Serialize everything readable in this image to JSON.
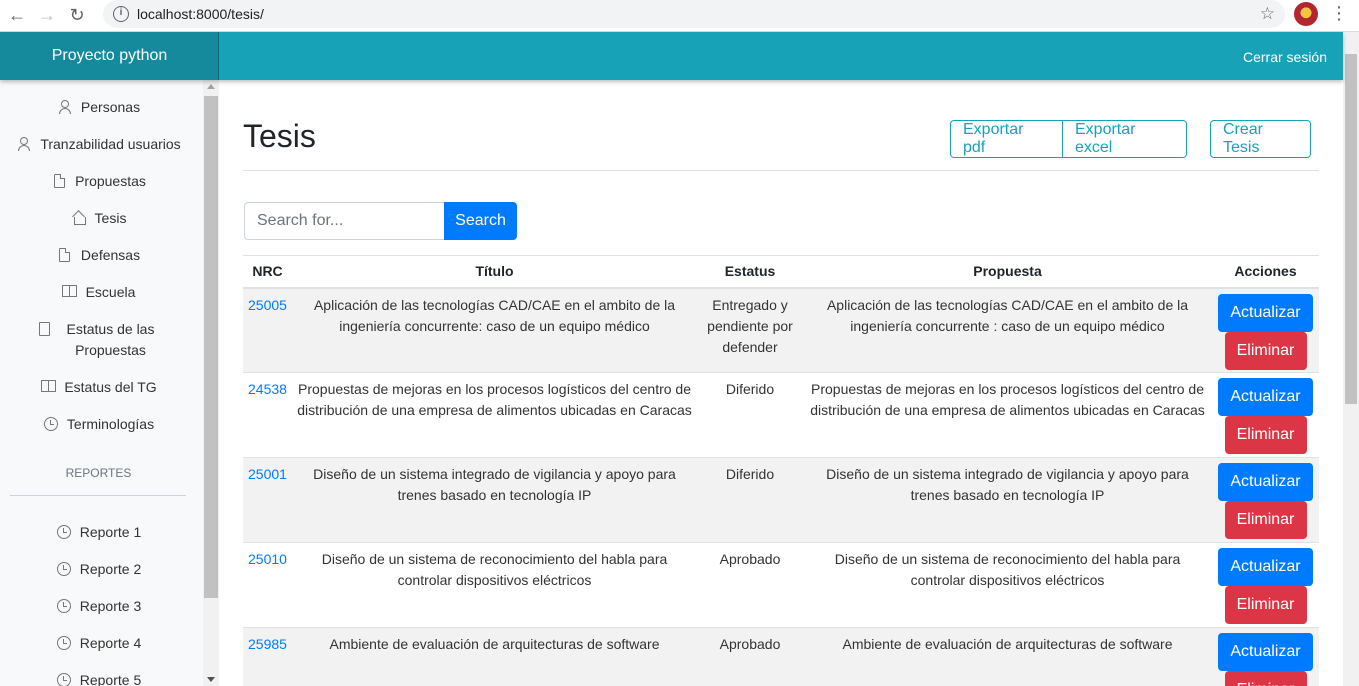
{
  "browser": {
    "url": "localhost:8000/tesis/"
  },
  "topbar": {
    "brand": "Proyecto python",
    "logout": "Cerrar sesión"
  },
  "sidebar": {
    "items": [
      {
        "label": "Personas",
        "icon": "people-icon"
      },
      {
        "label": "Tranzabilidad usuarios",
        "icon": "people-icon"
      },
      {
        "label": "Propuestas",
        "icon": "file-icon"
      },
      {
        "label": "Tesis",
        "icon": "home-icon"
      },
      {
        "label": "Defensas",
        "icon": "file-icon"
      },
      {
        "label": "Escuela",
        "icon": "book-open-icon"
      },
      {
        "label": "Estatus de las Propuestas",
        "icon": "book-icon"
      },
      {
        "label": "Estatus del TG",
        "icon": "book-open-icon"
      },
      {
        "label": "Terminologías",
        "icon": "clock-icon"
      }
    ],
    "reports_heading": "REPORTES",
    "reports": [
      {
        "label": "Reporte 1",
        "icon": "clock-icon"
      },
      {
        "label": "Reporte 2",
        "icon": "clock-icon"
      },
      {
        "label": "Reporte 3",
        "icon": "clock-icon"
      },
      {
        "label": "Reporte 4",
        "icon": "clock-icon"
      },
      {
        "label": "Reporte 5",
        "icon": "clock-icon"
      }
    ]
  },
  "main": {
    "title": "Tesis",
    "export_pdf": "Exportar pdf",
    "export_excel": "Exportar excel",
    "create": "Crear Tesis",
    "search_placeholder": "Search for...",
    "search_button": "Search"
  },
  "table": {
    "headers": [
      "NRC",
      "Título",
      "Estatus",
      "Propuesta",
      "Acciones"
    ],
    "update_label": "Actualizar",
    "delete_label": "Eliminar",
    "rows": [
      {
        "nrc": "25005",
        "titulo": "Aplicación de las tecnologías CAD/CAE en el ambito de la ingeniería concurrente: caso de un equipo médico",
        "estatus": "Entregado y pendiente por defender",
        "propuesta": "Aplicación de las tecnologías CAD/CAE en el ambito de la ingeniería concurrente : caso de un equipo médico"
      },
      {
        "nrc": "24538",
        "titulo": "Propuestas de mejoras en los procesos logísticos del centro de distribución de una empresa de alimentos ubicadas en Caracas",
        "estatus": "Diferido",
        "propuesta": "Propuestas de mejoras en los procesos logísticos del centro de distribución de una empresa de alimentos ubicadas en Caracas"
      },
      {
        "nrc": "25001",
        "titulo": "Diseño de un sistema integrado de vigilancia y apoyo para trenes basado en tecnología IP",
        "estatus": "Diferido",
        "propuesta": "Diseño de un sistema integrado de vigilancia y apoyo para trenes basado en tecnología IP"
      },
      {
        "nrc": "25010",
        "titulo": "Diseño de un sistema de reconocimiento del habla para controlar dispositivos eléctricos",
        "estatus": "Aprobado",
        "propuesta": "Diseño de un sistema de reconocimiento del habla para controlar dispositivos eléctricos"
      },
      {
        "nrc": "25985",
        "titulo": "Ambiente de evaluación de arquitecturas de software",
        "estatus": "Aprobado",
        "propuesta": "Ambiente de evaluación de arquitecturas de software"
      }
    ]
  },
  "colors": {
    "topbar": "#17a2b8",
    "brand_bg": "#148a9c",
    "primary": "#007bff",
    "danger": "#dc3545"
  }
}
